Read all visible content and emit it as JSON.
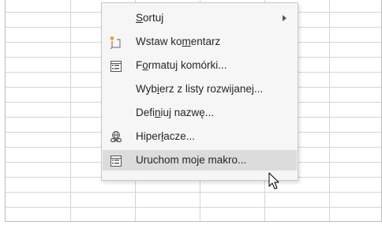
{
  "context_menu": {
    "items": [
      {
        "pre": "",
        "ul": "S",
        "post": "ortuj",
        "icon": "none",
        "submenu": true,
        "highlighted": false
      },
      {
        "pre": "Wstaw ko",
        "ul": "m",
        "post": "entarz",
        "icon": "insert-comment-icon",
        "submenu": false,
        "highlighted": false
      },
      {
        "pre": "F",
        "ul": "o",
        "post": "rmatuj komórki...",
        "icon": "format-cells-icon",
        "submenu": false,
        "highlighted": false
      },
      {
        "pre": "Wyb",
        "ul": "i",
        "post": "erz z listy rozwijanej...",
        "icon": "none",
        "submenu": false,
        "highlighted": false
      },
      {
        "pre": "Defi",
        "ul": "n",
        "post": "iuj nazwę...",
        "icon": "none",
        "submenu": false,
        "highlighted": false
      },
      {
        "pre": "Hiper",
        "ul": "ł",
        "post": "acze...",
        "icon": "hyperlink-icon",
        "submenu": false,
        "highlighted": false
      },
      {
        "pre": "Uruchom moje makro...",
        "ul": "",
        "post": "",
        "icon": "macro-list-icon",
        "submenu": false,
        "highlighted": true
      }
    ]
  },
  "colors": {
    "menu_bg": "#f6f6f6",
    "highlight_bg": "#dcdcdc",
    "grid_line": "#d4d4d4",
    "text": "#262626"
  }
}
